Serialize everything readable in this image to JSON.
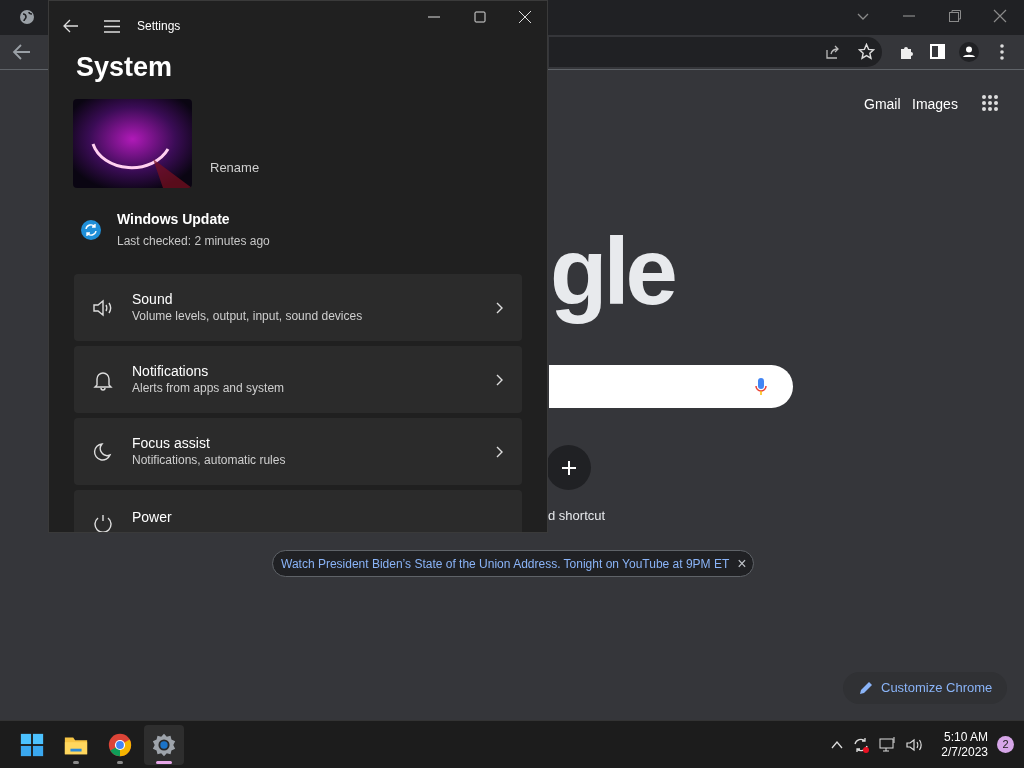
{
  "browser": {
    "page_links": [
      "Gmail",
      "Images"
    ],
    "logo_fragment": "gle",
    "shortcut_label": "d shortcut",
    "promo": {
      "text": "Watch President Biden’s State of the Union Address. Tonight on YouTube at 9PM ET",
      "close": "×"
    },
    "customize_button": "Customize Chrome"
  },
  "settings_window": {
    "title": "Settings",
    "heading": "System",
    "device": {
      "kind": "picture",
      "rename": "Rename"
    },
    "update": {
      "title": "Windows Update",
      "subtitle": "Last checked: 2 minutes ago"
    },
    "items": [
      {
        "kind": "sound",
        "title": "Sound",
        "subtitle": "Volume levels, output, input, sound devices"
      },
      {
        "kind": "notifications",
        "title": "Notifications",
        "subtitle": "Alerts from apps and system"
      },
      {
        "kind": "focus",
        "title": "Focus assist",
        "subtitle": "Notifications, automatic rules"
      },
      {
        "kind": "power",
        "title": "Power"
      }
    ]
  },
  "taskbar": {
    "apps": [
      {
        "kind": "start",
        "running": false,
        "selected": false
      },
      {
        "kind": "folder",
        "running": true,
        "selected": false
      },
      {
        "kind": "chrome",
        "running": true,
        "selected": false
      },
      {
        "kind": "settings",
        "running": true,
        "selected": true
      }
    ],
    "time": "5:10 AM",
    "date": "2/7/2023",
    "notification_count": "2"
  }
}
